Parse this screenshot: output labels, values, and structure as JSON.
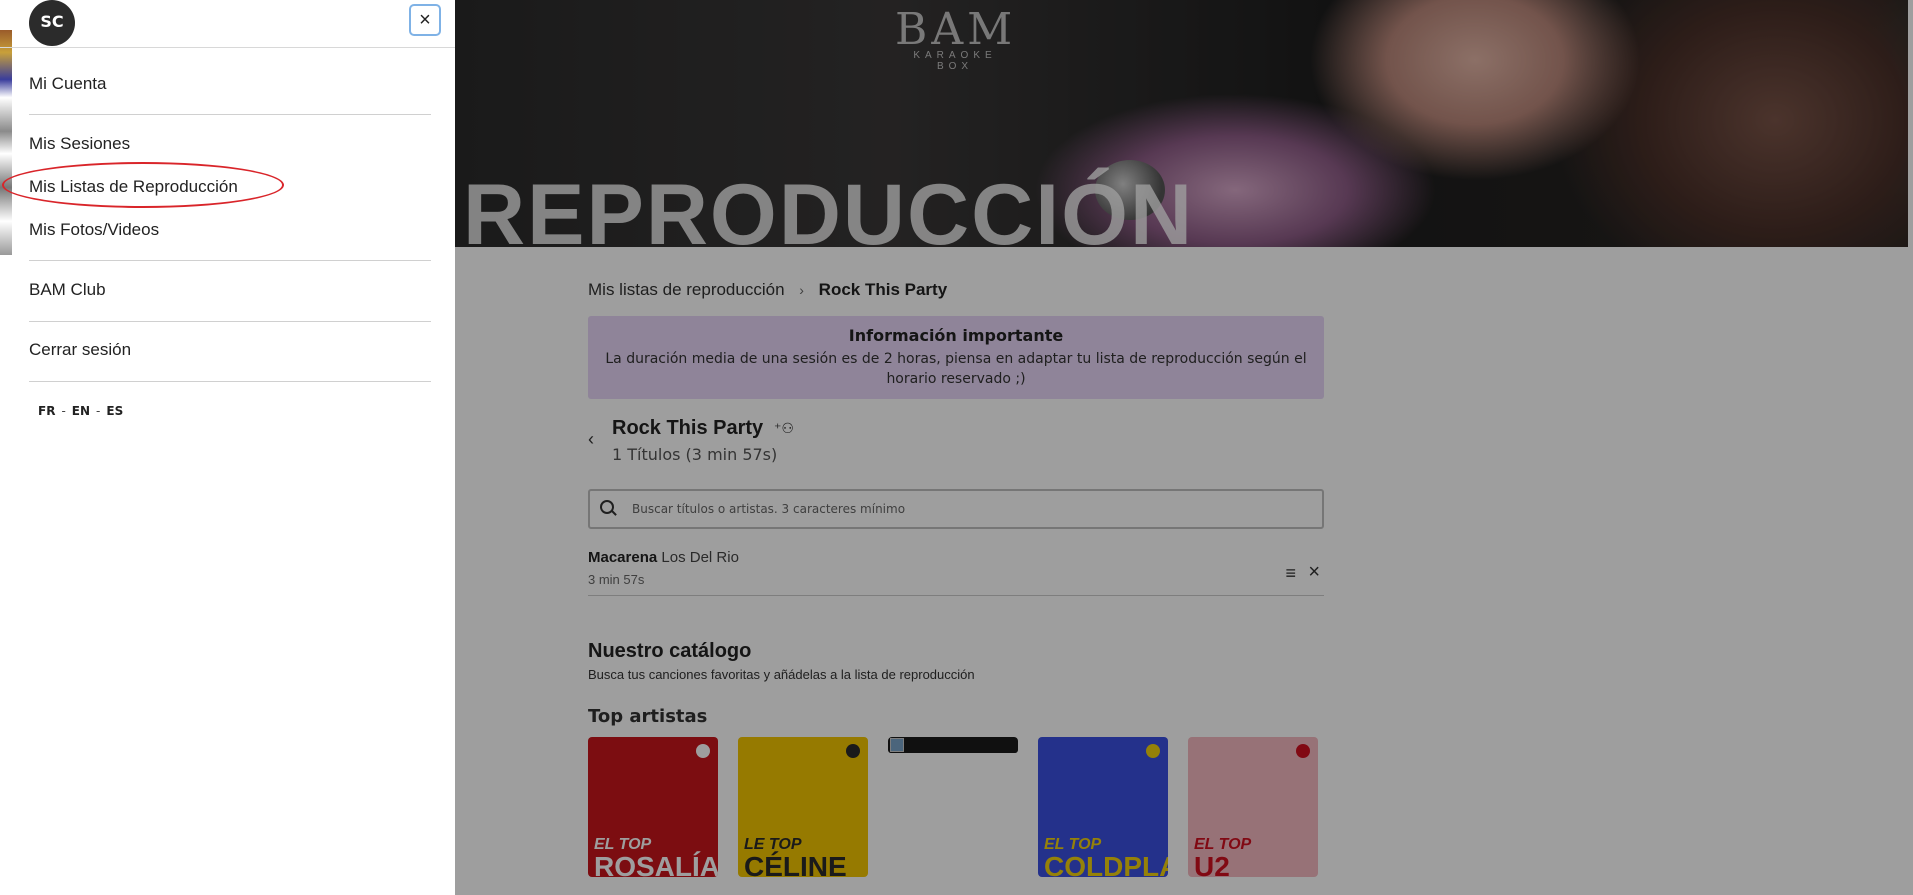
{
  "hero": {
    "logo_big": "BAM",
    "logo_small": "KARAOKE BOX",
    "title": "REPRODUCCIÓN"
  },
  "breadcrumb": {
    "parent": "Mis listas de reproducción",
    "separator": "›",
    "current": "Rock This Party"
  },
  "info": {
    "heading": "Información importante",
    "text": "La duración media de una sesión es de 2 horas, piensa en adaptar tu lista de reproducción según el horario reservado ;)"
  },
  "playlist": {
    "back_icon": "‹",
    "name": "Rock This Party",
    "share_icon": "⁺⚇",
    "count": "1 Títulos (3 min 57s)"
  },
  "search": {
    "placeholder": "Buscar títulos o artistas. 3 caracteres mínimo"
  },
  "songs": [
    {
      "title": "Macarena",
      "artist": "Los Del Rio",
      "duration": "3 min 57s"
    }
  ],
  "catalog": {
    "title": "Nuestro catálogo",
    "subtitle": "Busca tus canciones favoritas y añádelas a la lista de reproducción",
    "top_artists_title": "Top artistas",
    "cards": [
      {
        "small": "EL TOP",
        "big": "ROSALÍA",
        "bg": "#c8161c",
        "fg": "#ffffff",
        "dot": "#ffffff"
      },
      {
        "small": "LE TOP",
        "big": "CÉLINE",
        "bg": "#f2c500",
        "fg": "#2a2a2a",
        "dot": "#2a2a2a"
      },
      {
        "small": "",
        "big": "",
        "bg": "transparent",
        "fg": "#000000",
        "dot": ""
      },
      {
        "small": "EL TOP",
        "big": "COLDPLAY",
        "bg": "#3a4fe0",
        "fg": "#f0d010",
        "dot": "#f0d010"
      },
      {
        "small": "EL TOP",
        "big": "U2",
        "bg": "#f4b8c0",
        "fg": "#d01020",
        "dot": "#d01020"
      }
    ]
  },
  "drawer": {
    "avatar": "SC",
    "close_icon": "×",
    "items": {
      "mi_cuenta": "Mi Cuenta",
      "mis_sesiones": "Mis Sesiones",
      "mis_listas": "Mis Listas de Reproducción",
      "mis_fotos": "Mis Fotos/Videos",
      "bam_club": "BAM Club",
      "cerrar": "Cerrar sesión"
    },
    "languages": [
      "FR",
      "EN",
      "ES"
    ],
    "lang_separator": "-"
  },
  "colors": {
    "info_bg": "#e7d6f7",
    "highlight": "#d9252a",
    "close_border": "#7fb2e6"
  }
}
